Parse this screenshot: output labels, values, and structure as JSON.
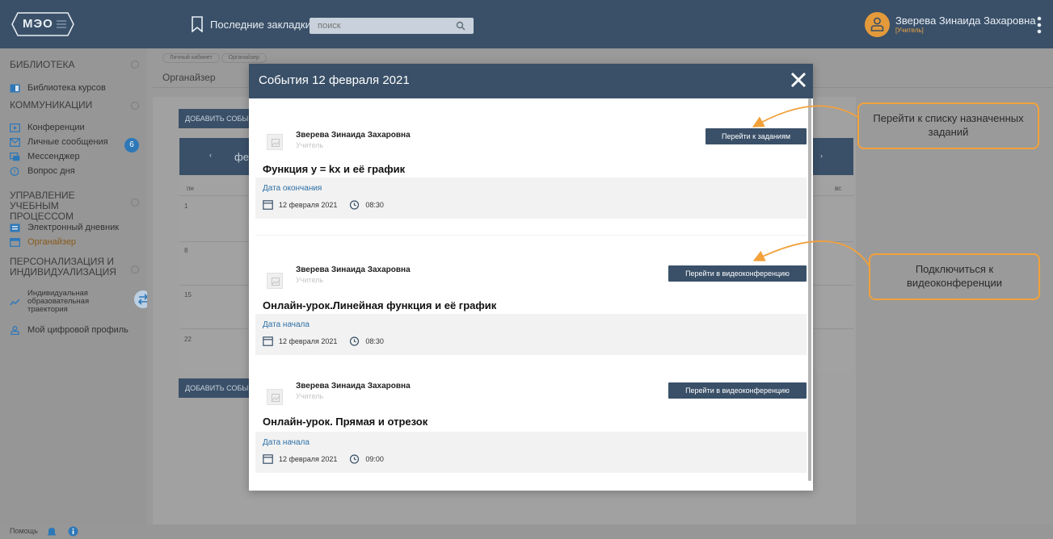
{
  "header": {
    "logo_text": "МЭО",
    "bookmarks_label": "Последние закладки",
    "search_placeholder": "поиск",
    "user_name": "Зверева Зинаида Захаровна",
    "user_role": "[Учитель]"
  },
  "sidebar": {
    "sections": [
      {
        "title": "БИБЛИОТЕКА",
        "items": [
          {
            "label": "Библиотека курсов",
            "icon": "book-icon"
          }
        ]
      },
      {
        "title": "КОММУНИКАЦИИ",
        "items": [
          {
            "label": "Конференции",
            "icon": "video-icon"
          },
          {
            "label": "Личные сообщения",
            "icon": "mail-icon",
            "badge": "6"
          },
          {
            "label": "Мессенджер",
            "icon": "chat-icon"
          },
          {
            "label": "Вопрос дня",
            "icon": "question-icon"
          }
        ]
      },
      {
        "title": "УПРАВЛЕНИЕ УЧЕБНЫМ ПРОЦЕССОМ",
        "items": [
          {
            "label": "Электронный дневник",
            "icon": "diary-icon"
          },
          {
            "label": "Органайзер",
            "icon": "calendar-icon",
            "active": true
          }
        ]
      },
      {
        "title": "ПЕРСОНАЛИЗАЦИЯ И ИНДИВИДУАЛИЗАЦИЯ",
        "items": [
          {
            "label": "Индивидуальная образовательная траектория",
            "icon": "trajectory-icon"
          },
          {
            "label": "Мой цифровой профиль",
            "icon": "profile-icon"
          }
        ]
      }
    ]
  },
  "footer": {
    "help_label": "Помощь"
  },
  "breadcrumbs": [
    "Личный кабинет",
    "Органайзер"
  ],
  "page_title": "Органайзер",
  "add_event_label": "ДОБАВИТЬ СОБЫ",
  "calendar": {
    "prev": "‹",
    "month": "фе",
    "next": "›",
    "weekday_first": "пн",
    "weekday_last": "вс",
    "day_numbers": [
      "1",
      "8",
      "15",
      "22"
    ]
  },
  "modal": {
    "title": "События 12 февраля 2021",
    "close_icon": "close-icon",
    "events": [
      {
        "author": "Зверева Зинаида Захаровна",
        "role": "Учитель",
        "action_label": "Перейти к заданиям",
        "title": "Функция у = kx и её график",
        "date_label": "Дата окончания",
        "date": "12 февраля 2021",
        "time": "08:30"
      },
      {
        "author": "Зверева Зинаида Захаровна",
        "role": "Учитель",
        "action_label": "Перейти в видеоконференцию",
        "title": "Онлайн-урок.Линейная функция и её график",
        "date_label": "Дата начала",
        "date": "12 февраля 2021",
        "time": "08:30"
      },
      {
        "author": "Зверева Зинаида Захаровна",
        "role": "Учитель",
        "action_label": "Перейти в видеоконференцию",
        "title": "Онлайн-урок. Прямая и отрезок",
        "date_label": "Дата начала",
        "date": "12 февраля 2021",
        "time": "09:00"
      }
    ]
  },
  "annotations": {
    "callout_tasks": "Перейти к списку назначенных заданий",
    "callout_video": "Подключиться к видеоконференции"
  },
  "colors": {
    "header_bg": "#3a5068",
    "accent_orange": "#f2a13b",
    "link_blue": "#2d6fa6",
    "badge_blue": "#2e78b8"
  }
}
